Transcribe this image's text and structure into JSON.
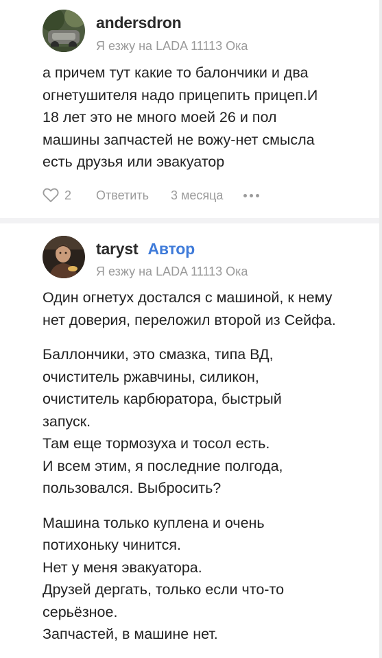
{
  "comments": [
    {
      "username": "andersdron",
      "car": "Я езжу на LADA 11113 Ока",
      "paragraphs": [
        [
          "а причем тут какие то балончики и два",
          "огнетушителя надо прицепить прицеп.И",
          "18 лет это не много моей 26 и пол",
          "машины запчастей не вожу-нет смысла",
          "есть друзья или эвакуатор"
        ]
      ],
      "likes": "2",
      "reply_label": "Ответить",
      "age": "3 месяца"
    },
    {
      "username": "taryst",
      "author_badge": "Автор",
      "car": "Я езжу на LADA 11113 Ока",
      "paragraphs": [
        [
          "Один огнетух достался с машиной, к нему",
          "нет доверия, переложил второй из Сейфа."
        ],
        [
          "Баллончики, это смазка, типа ВД,",
          "очиститель ржавчины, силикон,",
          "очиститель карбюратора, быстрый",
          "запуск.",
          "Там еще тормозуха и тосол есть.",
          "И всем этим, я последние полгода,",
          "пользовался. Выбросить?"
        ],
        [
          "Машина только куплена и очень",
          "потихоньку чинится.",
          "Нет у меня эвакуатора.",
          "Друзей дергать, только если что-то",
          "серьёзное.",
          "Запчастей, в машине нет."
        ]
      ]
    }
  ],
  "icons": {
    "like": "heart-outline-icon",
    "more": "more-dots-icon"
  },
  "colors": {
    "author_badge": "#3f7bd9",
    "muted": "#9a9a9a",
    "text": "#232323"
  }
}
